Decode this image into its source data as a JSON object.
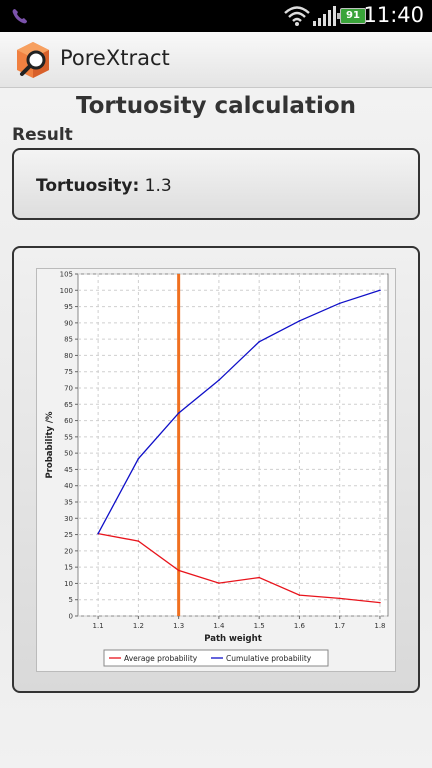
{
  "status_bar": {
    "time": "11:40",
    "battery": "91",
    "icons": [
      "viber-icon",
      "wifi-icon",
      "signal-icon",
      "battery-icon"
    ]
  },
  "app": {
    "title": "PoreXtract",
    "logo": "porextract-logo"
  },
  "page": {
    "title": "Tortuosity calculation",
    "result_section_label": "Result",
    "tortuosity_label": "Tortuosity:",
    "tortuosity_value": "1.3"
  },
  "colors": {
    "average_series": "#e8141c",
    "cumulative_series": "#1010c8",
    "marker_line": "#f07020"
  },
  "chart_data": {
    "type": "line",
    "xlabel": "Path weight",
    "ylabel": "Probability /%",
    "xlim": [
      1.1,
      1.8
    ],
    "ylim": [
      0,
      105
    ],
    "x_ticks": [
      "1.1",
      "1.2",
      "1.3",
      "1.4",
      "1.5",
      "1.6",
      "1.7",
      "1.8"
    ],
    "y_ticks": [
      "0",
      "5",
      "10",
      "15",
      "20",
      "25",
      "30",
      "35",
      "40",
      "45",
      "50",
      "55",
      "60",
      "65",
      "70",
      "75",
      "80",
      "85",
      "90",
      "95",
      "100",
      "105"
    ],
    "grid": true,
    "legend_position": "bottom",
    "marker_x": 1.3,
    "x": [
      1.1,
      1.2,
      1.3,
      1.4,
      1.5,
      1.6,
      1.7,
      1.8
    ],
    "series": [
      {
        "name": "Average probability",
        "values": [
          25.3,
          23.0,
          14.0,
          10.1,
          11.8,
          6.4,
          5.4,
          4.1
        ]
      },
      {
        "name": "Cumulative probability",
        "values": [
          25.3,
          48.3,
          62.3,
          72.4,
          84.2,
          90.6,
          96.0,
          100.0
        ]
      }
    ]
  }
}
